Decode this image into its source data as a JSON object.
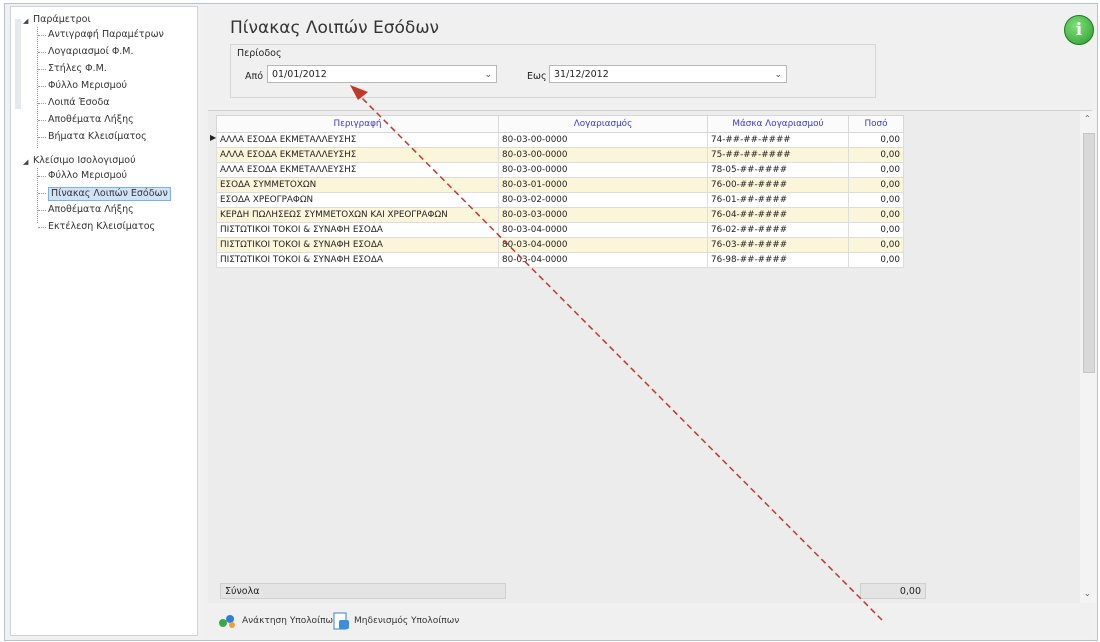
{
  "tree": {
    "root1": "Παράμετροι",
    "root1_children": [
      "Αντιγραφή Παραμέτρων",
      "Λογαριασμοί Φ.Μ.",
      "Στήλες Φ.Μ.",
      "Φύλλο Μερισμού",
      "Λοιπά Έσοδα",
      "Αποθέματα Λήξης",
      "Βήματα Κλεισίματος"
    ],
    "root2": "Κλείσιμο Ισολογισμού",
    "root2_children": [
      "Φύλλο Μερισμού",
      "Πίνακας Λοιπών Εσόδων",
      "Αποθέματα Λήξης",
      "Εκτέλεση Κλεισίματος"
    ],
    "selected_index": 1
  },
  "header": {
    "title": "Πίνακας Λοιπών Εσόδων",
    "info_icon": "i"
  },
  "period": {
    "label": "Περίοδος",
    "from_label": "Από",
    "from_value": "01/01/2012",
    "to_label": "Εως",
    "to_value": "31/12/2012"
  },
  "grid": {
    "columns": [
      "Περιγραφή",
      "Λογαριασμός",
      "Μάσκα Λογαριασμού",
      "Ποσό"
    ],
    "rows": [
      [
        "ΑΛΛΑ ΕΣΟΔΑ ΕΚΜΕΤΑΛΛΕΥΣΗΣ",
        "80-03-00-0000",
        "74-##-##-####",
        "0,00"
      ],
      [
        "ΑΛΛΑ ΕΣΟΔΑ ΕΚΜΕΤΑΛΛΕΥΣΗΣ",
        "80-03-00-0000",
        "75-##-##-####",
        "0,00"
      ],
      [
        "ΑΛΛΑ ΕΣΟΔΑ ΕΚΜΕΤΑΛΛΕΥΣΗΣ",
        "80-03-00-0000",
        "78-05-##-####",
        "0,00"
      ],
      [
        "ΕΣΟΔΑ ΣΥΜΜΕΤΟΧΩΝ",
        "80-03-01-0000",
        "76-00-##-####",
        "0,00"
      ],
      [
        "ΕΣΟΔΑ ΧΡΕΟΓΡΑΦΩΝ",
        "80-03-02-0000",
        "76-01-##-####",
        "0,00"
      ],
      [
        "ΚΕΡΔΗ ΠΩΛΗΣΕΩΣ ΣΥΜΜΕΤΟΧΩΝ ΚΑΙ ΧΡΕΟΓΡΑΦΩΝ",
        "80-03-03-0000",
        "76-04-##-####",
        "0,00"
      ],
      [
        "ΠΙΣΤΩΤΙΚΟΙ ΤΟΚΟΙ & ΣΥΝΑΦΗ ΕΣΟΔΑ",
        "80-03-04-0000",
        "76-02-##-####",
        "0,00"
      ],
      [
        "ΠΙΣΤΩΤΙΚΟΙ ΤΟΚΟΙ & ΣΥΝΑΦΗ ΕΣΟΔΑ",
        "80-03-04-0000",
        "76-03-##-####",
        "0,00"
      ],
      [
        "ΠΙΣΤΩΤΙΚΟΙ ΤΟΚΟΙ & ΣΥΝΑΦΗ ΕΣΟΔΑ",
        "80-03-04-0000",
        "76-98-##-####",
        "0,00"
      ]
    ],
    "totals_label": "Σύνολα",
    "totals_value": "0,00"
  },
  "buttons": {
    "recalc_label": "Ανάκτηση Υπολοίπων",
    "reset_label": "Μηδενισμός Υπολοίπων"
  },
  "colors": {
    "header_text": "#3a3ad0",
    "alt_row": "#fbf6d9",
    "annotation_arrow": "#c0392b"
  },
  "icons": {
    "expand": "triangle-icon",
    "info": "info-icon",
    "recalc": "recalc-icon",
    "reset": "reset-icon",
    "row_pointer": "row-pointer-icon"
  }
}
